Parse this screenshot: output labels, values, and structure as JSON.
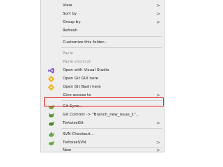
{
  "menu": {
    "items": {
      "view": {
        "label": "View"
      },
      "sort_by": {
        "label": "Sort by"
      },
      "group_by": {
        "label": "Group by"
      },
      "refresh": {
        "label": "Refresh"
      },
      "customize": {
        "label": "Customize this folder..."
      },
      "paste": {
        "label": "Paste"
      },
      "paste_shortcut": {
        "label": "Paste shortcut"
      },
      "open_vs": {
        "label": "Open with Visual Studio"
      },
      "git_gui": {
        "label": "Open Git GUI here"
      },
      "git_bash": {
        "label": "Open Git Bash here"
      },
      "give_access": {
        "label": "Give access to"
      },
      "git_sync": {
        "label": "Git Sync..."
      },
      "git_commit": {
        "label": "Git Commit -> \"Branch_new_issue_1\"..."
      },
      "tortoisegit": {
        "label": "TortoiseGit"
      },
      "svn_checkout": {
        "label": "SVN Checkout..."
      },
      "tortoisesvn": {
        "label": "TortoiseSVN"
      },
      "new": {
        "label": "New"
      },
      "properties": {
        "label": "Properties"
      }
    },
    "submenu_glyph": ">",
    "highlight_color": "#e0201a"
  },
  "icons": {
    "open_vs": "visual-studio-icon",
    "git_gui": "git-gui-icon",
    "git_bash": "git-bash-icon",
    "git_sync": "tortoisegit-sync-icon",
    "git_commit": "tortoisegit-commit-icon",
    "tortoisegit": "tortoisegit-icon",
    "svn_checkout": "svn-checkout-icon",
    "tortoisesvn": "tortoisesvn-icon"
  }
}
